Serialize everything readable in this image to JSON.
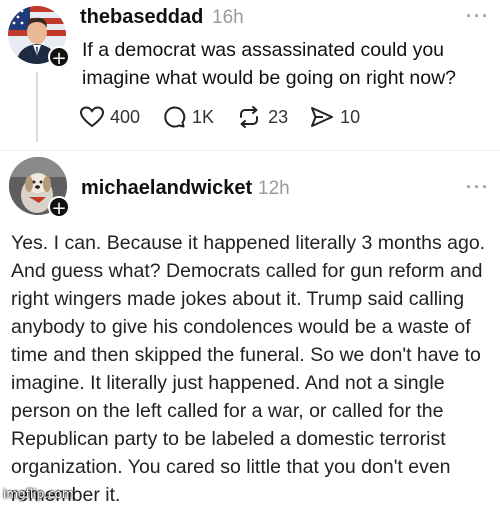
{
  "post": {
    "username": "thebaseddad",
    "time": "16h",
    "more": "···",
    "text": "If a democrat was assassinated could you imagine what would be going on right now?",
    "stats": {
      "likes": "400",
      "replies": "1K",
      "reposts": "23",
      "shares": "10"
    }
  },
  "reply": {
    "username": "michaelandwicket",
    "time": "12h",
    "more": "···",
    "text": "Yes. I can. Because it happened literally 3 months ago. And guess what? Democrats called for gun reform and right wingers made jokes about it. Trump said calling anybody to give his condolences would be a waste of time and then skipped the funeral. So we don't have to imagine. It literally just happened. And not a single person on the left called for a war, or called for the Republican party to be labeled a domestic terrorist organization. You cared so little that you don't even remember it."
  },
  "watermark": "imgflip.com",
  "colors": {
    "text": "#111111",
    "muted": "#9a9a9a",
    "background": "#ffffff"
  }
}
